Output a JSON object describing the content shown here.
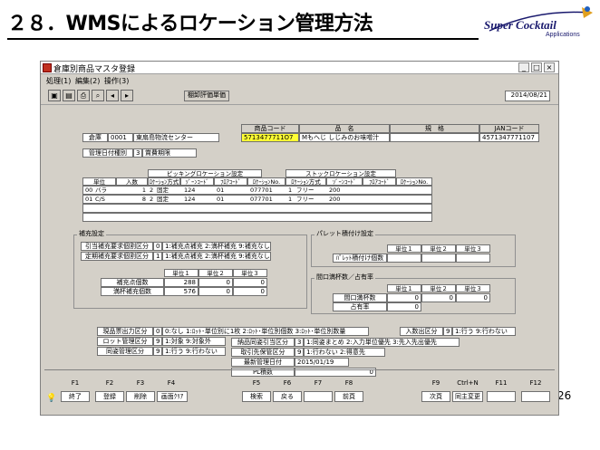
{
  "slide": {
    "title": "２８．WMSによるロケーション管理方法",
    "logo_line1": "Super Cocktail",
    "logo_line2": "Applications",
    "page_number": "26"
  },
  "window": {
    "title": "倉庫別商品マスタ登録",
    "menu": [
      "処理(1)",
      "編集(2)",
      "操作(3)"
    ],
    "shelf_button": "棚卸評価単価",
    "date": "2014/08/21"
  },
  "product": {
    "labels": {
      "code": "商品コード",
      "name": "品　名",
      "spec": "規　格",
      "jan": "JANコード"
    },
    "code": "5713477711O7",
    "name": "Mもへじ しじみのお味噌汁",
    "spec": "",
    "jan": "4571347771107"
  },
  "warehouse": {
    "label": "倉庫",
    "code": "0001",
    "name": "東扇島物流センター"
  },
  "date_mgmt": {
    "label": "管理日付種別",
    "code": "3",
    "value": "賞費期限"
  },
  "picking": {
    "section": "ピッキングロケーション設定",
    "unit_header": "単位",
    "qty_header": "入数",
    "columns": [
      "ﾛｹｰｼｮﾝ方式",
      "ｿﾞｰﾝｺｰﾄﾞ",
      "ﾌﾛｱｺｰﾄﾞ",
      "ﾛｹｰｼｮﾝNo."
    ],
    "rows": [
      {
        "code": "00",
        "unit": "バラ",
        "qty": "1",
        "method_code": "2",
        "method": "固定",
        "zone": "124",
        "floor": "01",
        "loc": "077701"
      },
      {
        "code": "01",
        "unit": "C/S",
        "qty": "8",
        "method_code": "2",
        "method": "固定",
        "zone": "124",
        "floor": "01",
        "loc": "077701"
      }
    ]
  },
  "stock": {
    "section": "ストックロケーション設定",
    "columns": [
      "ﾛｹｰｼｮﾝ方式",
      "ｿﾞｰﾝｺｰﾄﾞ",
      "ﾌﾛｱｺｰﾄﾞ",
      "ﾛｹｰｼｮﾝNo."
    ],
    "rows": [
      {
        "method_code": "1",
        "method": "フリー",
        "zone": "200"
      },
      {
        "method_code": "1",
        "method": "フリー",
        "zone": "200"
      }
    ]
  },
  "replenish": {
    "section": "補充設定",
    "rows": [
      {
        "label": "引当補充要求個割区分",
        "code": "0",
        "value": "1:補充点補充 2:満杯補充 9:補充なし"
      },
      {
        "label": "定期補充要求個割区分",
        "code": "1",
        "value": "1:補充点補充 2:満杯補充 9:補充なし"
      }
    ],
    "unit_headers": [
      "単位１",
      "単位２",
      "単位３"
    ],
    "qty_rows": [
      {
        "label": "補充点個数",
        "values": [
          "288",
          "0",
          "0"
        ]
      },
      {
        "label": "満杯補充個数",
        "values": [
          "576",
          "0",
          "0"
        ]
      }
    ]
  },
  "pallet": {
    "section": "パレット積付け設定",
    "unit_headers": [
      "単位１",
      "単位２",
      "単位３"
    ],
    "row_label": "ﾊﾟﾚｯﾄ積付け個数"
  },
  "frontage": {
    "section": "間口満杯数／占有率",
    "unit_headers": [
      "単位１",
      "単位２",
      "単位３"
    ],
    "rows": [
      {
        "label": "間口満杯数",
        "values": [
          "0",
          "0",
          "0"
        ]
      },
      {
        "label": "占有率",
        "values": [
          "0",
          "",
          ""
        ]
      }
    ]
  },
  "bottom": {
    "left": [
      {
        "label": "現品票出力区分",
        "code": "0",
        "value": "0:なし 1:ﾛｯﾄ･単位別に1枚 2:ﾛｯﾄ･単位別個数 3:ﾛｯﾄ･単位別数量"
      },
      {
        "label": "ロット管理区分",
        "code": "9",
        "value": "1:対象 9:対象外"
      },
      {
        "label": "同姿管理区分",
        "code": "9",
        "value": "1:行う 9:行わない"
      }
    ],
    "inout": {
      "label": "入数出区分",
      "code": "9",
      "value": "1:行う 9:行わない"
    },
    "mid": [
      {
        "label": "納品同姿引当区分",
        "code": "3",
        "value": "1:同姿まとめ 2:入力単位優先 3:先入先出優先"
      },
      {
        "label": "取引先保管区分",
        "code": "9",
        "value": "1:行わない 2:得意先"
      },
      {
        "label": "最新管理日付",
        "code": "",
        "value": "2015/01/19"
      },
      {
        "label": "PL積数",
        "code": "",
        "value": "0"
      }
    ]
  },
  "fkeys": [
    {
      "key": "F1",
      "label": "終了"
    },
    {
      "key": "F2",
      "label": "登録"
    },
    {
      "key": "F3",
      "label": "削除"
    },
    {
      "key": "F4",
      "label": "画面ｸﾘｱ"
    },
    {
      "key": "F5",
      "label": "検索"
    },
    {
      "key": "F6",
      "label": "戻る"
    },
    {
      "key": "F7",
      "label": ""
    },
    {
      "key": "F8",
      "label": "前頁"
    },
    {
      "key": "F9",
      "label": "次頁"
    },
    {
      "key": "Ctrl+N",
      "label": "同主変更"
    },
    {
      "key": "F11",
      "label": ""
    },
    {
      "key": "F12",
      "label": ""
    }
  ]
}
